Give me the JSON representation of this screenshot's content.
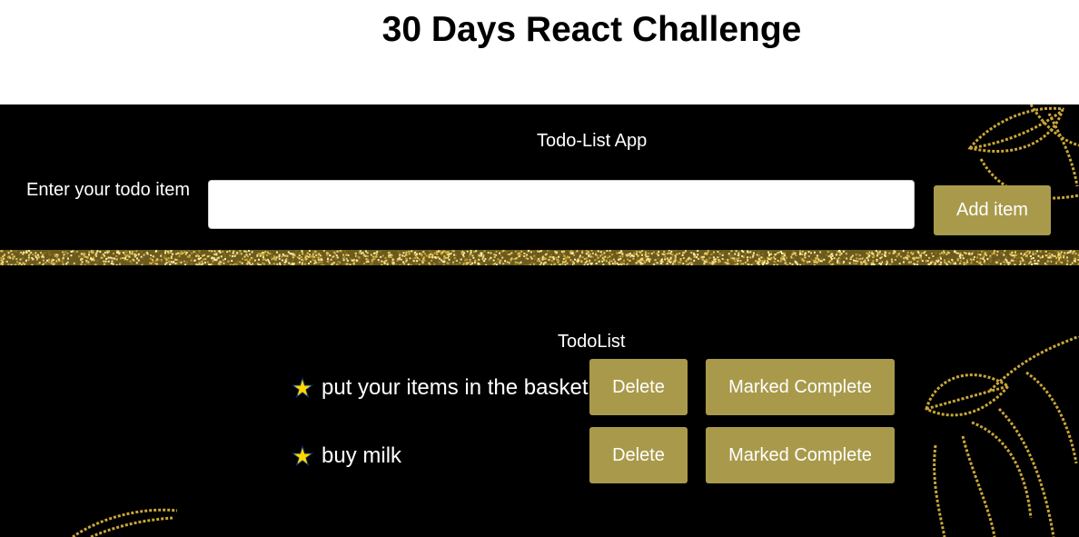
{
  "header": {
    "title": "30 Days React Challenge"
  },
  "app": {
    "title": "Todo-List App",
    "input_label": "Enter your todo item",
    "input_value": "",
    "input_placeholder": "",
    "add_button_label": "Add item"
  },
  "list": {
    "title": "TodoList",
    "items": [
      {
        "text": "put your items in the basket",
        "delete_label": "Delete",
        "complete_label": "Marked Complete"
      },
      {
        "text": "buy milk",
        "delete_label": "Delete",
        "complete_label": "Marked Complete"
      }
    ]
  },
  "colors": {
    "panel_background": "#000000",
    "button_gold": "#a99a4b",
    "star": "#ffd700",
    "decor_gold": "#c9a63a"
  },
  "icons": {
    "item_marker": "star-icon"
  }
}
